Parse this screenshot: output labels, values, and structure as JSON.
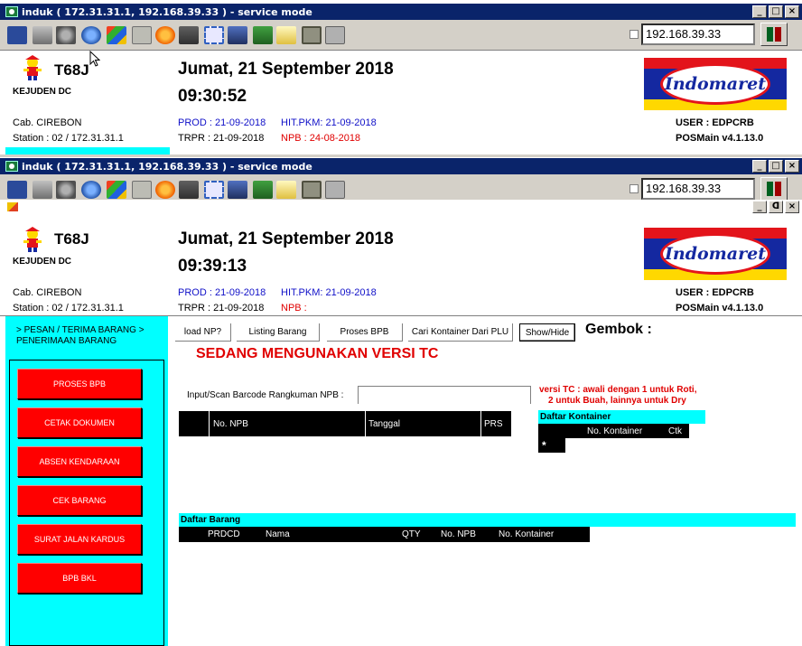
{
  "window1": {
    "title": "induk ( 172.31.31.1, 192.168.39.33 ) - service mode",
    "ip": "192.168.39.33",
    "store_code": "T68J",
    "dc_name": "KEJUDEN DC",
    "date": "Jumat, 21 September 2018",
    "time": "09:30:52",
    "branch": "Cab. CIREBON",
    "station": "Station : 02 / 172.31.31.1",
    "prod": "PROD : 21-09-2018",
    "hit_pkm": "HIT.PKM: 21-09-2018",
    "trpr": "TRPR : 21-09-2018",
    "npb": "NPB : 24-08-2018",
    "user": "USER : EDPCRB",
    "version": "POSMain v4.1.13.0",
    "logo_text": "Indomaret"
  },
  "window2": {
    "title": "induk ( 172.31.31.1, 192.168.39.33 ) - service mode",
    "ip": "192.168.39.33",
    "store_code": "T68J",
    "dc_name": "KEJUDEN DC",
    "date": "Jumat, 21 September 2018",
    "time": "09:39:13",
    "branch": "Cab. CIREBON",
    "station": "Station : 02 / 172.31.31.1",
    "prod": "PROD : 21-09-2018",
    "hit_pkm": "HIT.PKM: 21-09-2018",
    "trpr": "TRPR : 21-09-2018",
    "npb": "NPB :",
    "user": "USER : EDPCRB",
    "version": "POSMain v4.1.13.0",
    "logo_text": "Indomaret"
  },
  "window_buttons": {
    "minimize": "_",
    "maximize": "□",
    "close": "×",
    "restore": "ᗡ"
  },
  "sidebar": {
    "breadcrumb_line1": "> PESAN / TERIMA BARANG >",
    "breadcrumb_line2": "PENERIMAAN BARANG",
    "buttons": [
      "PROSES BPB",
      "CETAK DOKUMEN",
      "ABSEN KENDARAAN",
      "CEK BARANG",
      "SURAT JALAN KARDUS",
      "BPB BKL"
    ]
  },
  "main": {
    "tabs": [
      "load NP?",
      "Listing Barang",
      "Proses BPB",
      "Cari Kontainer Dari PLU",
      "Show/Hide"
    ],
    "gembok_label": "Gembok :",
    "version_notice": "SEDANG MENGUNAKAN VERSI TC",
    "input_label": "Input/Scan Barcode Rangkuman NPB :",
    "input_value": "",
    "npb_columns": [
      "No. NPB",
      "Tanggal",
      "PRS"
    ],
    "tc_note_line1": "versi TC : awali dengan 1 untuk Roti,",
    "tc_note_line2": "2 untuk Buah, lainnya untuk Dry",
    "kontainer_title": "Daftar Kontainer",
    "kontainer_columns": [
      "No. Kontainer",
      "Ctk"
    ],
    "kontainer_new_row": "*",
    "barang_title": "Daftar Barang",
    "barang_columns": [
      "PRDCD",
      "Nama",
      "QTY",
      "No. NPB",
      "No. Kontainer"
    ]
  },
  "colors": {
    "titlebar": "#0a246a",
    "accent_cyan": "#00ffff",
    "button_red": "#ff0000",
    "text_blue": "#1010c8",
    "text_red": "#e00000"
  },
  "icons": [
    "monitor-icon",
    "windows-icon",
    "tools-icon",
    "refresh-icon",
    "flag-icon",
    "drive-icon",
    "alert-icon",
    "network-error-icon",
    "fullscreen-icon",
    "display-icon",
    "download-icon",
    "note-icon",
    "chip-icon",
    "copy-icon"
  ]
}
